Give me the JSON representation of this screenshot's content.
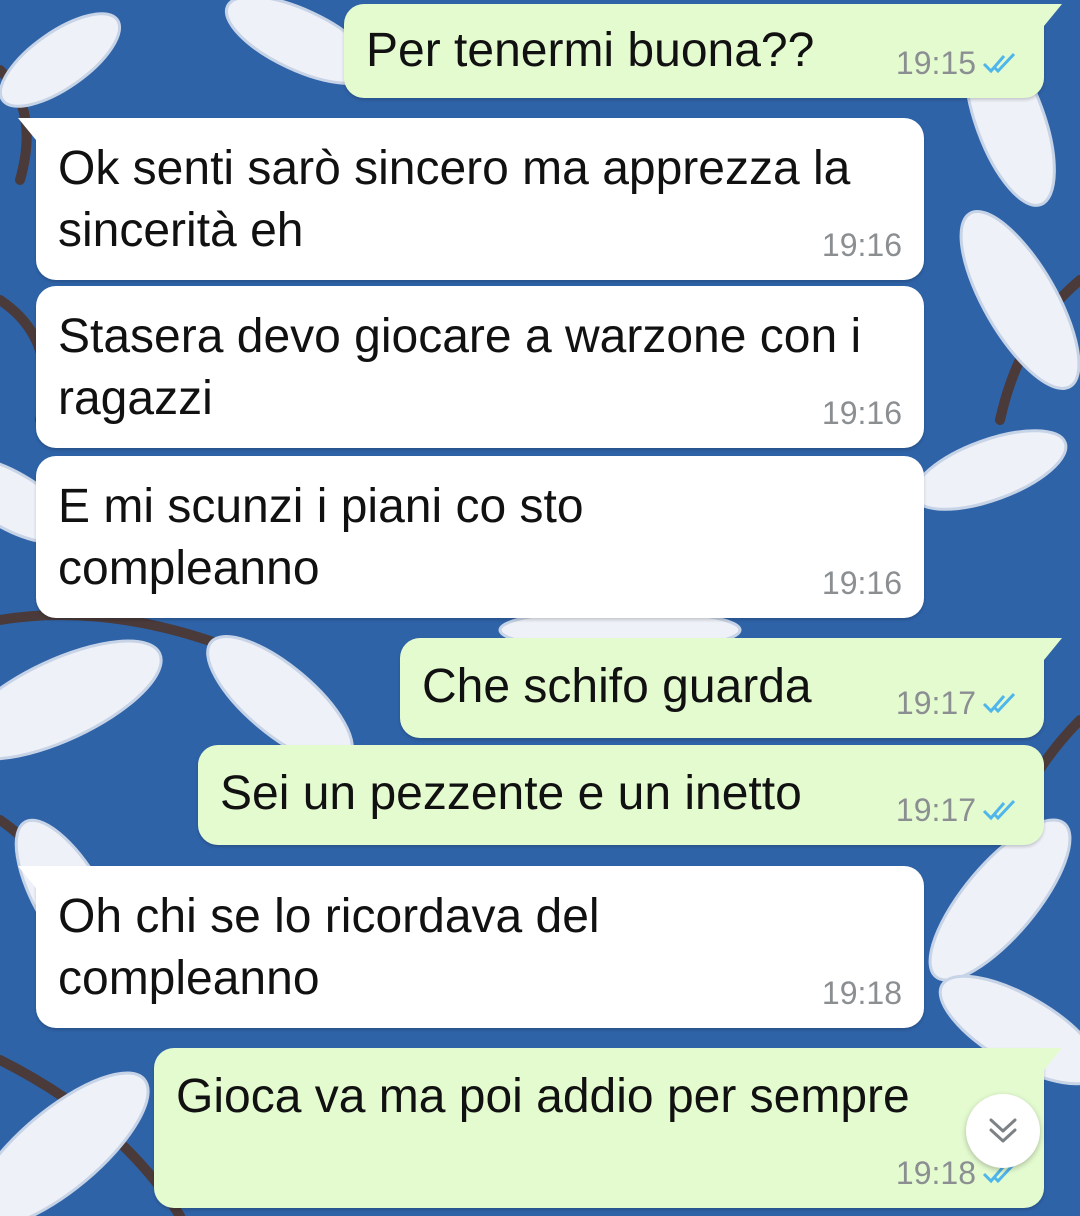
{
  "colors": {
    "incoming_bubble": "#ffffff",
    "outgoing_bubble": "#e4fbd0",
    "read_ticks": "#4fb6ec",
    "wallpaper_sky": "#2f63a8"
  },
  "messages": [
    {
      "direction": "outgoing",
      "text": "Per tenermi buona??",
      "time": "19:15",
      "status_icon": "double-check-read-icon"
    },
    {
      "direction": "incoming",
      "text": "Ok senti sarò sincero ma apprezza la sincerità eh",
      "time": "19:16"
    },
    {
      "direction": "incoming",
      "text": "Stasera devo giocare a warzone con i ragazzi",
      "time": "19:16"
    },
    {
      "direction": "incoming",
      "text": "E mi scunzi i piani co sto compleanno",
      "time": "19:16"
    },
    {
      "direction": "outgoing",
      "text": "Che schifo guarda",
      "time": "19:17",
      "status_icon": "double-check-read-icon"
    },
    {
      "direction": "outgoing",
      "text": "Sei un pezzente e un inetto",
      "time": "19:17",
      "status_icon": "double-check-read-icon"
    },
    {
      "direction": "incoming",
      "text": "Oh chi se lo ricordava del compleanno",
      "time": "19:18"
    },
    {
      "direction": "outgoing",
      "text": "Gioca va ma poi addio per sempre",
      "time": "19:18",
      "status_icon": "double-check-read-icon"
    }
  ],
  "scroll_button": {
    "icon": "double-chevron-down-icon"
  }
}
